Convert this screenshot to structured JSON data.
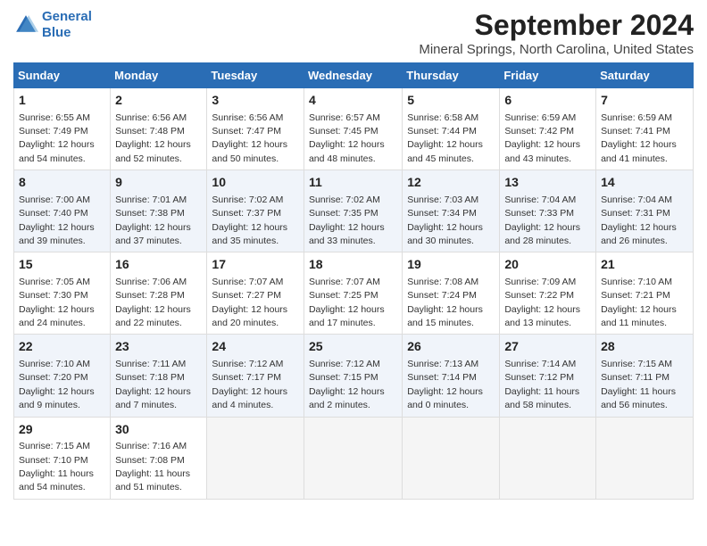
{
  "logo": {
    "line1": "General",
    "line2": "Blue"
  },
  "header": {
    "title": "September 2024",
    "subtitle": "Mineral Springs, North Carolina, United States"
  },
  "weekdays": [
    "Sunday",
    "Monday",
    "Tuesday",
    "Wednesday",
    "Thursday",
    "Friday",
    "Saturday"
  ],
  "weeks": [
    [
      {
        "day": "1",
        "sunrise": "6:55 AM",
        "sunset": "7:49 PM",
        "daylight": "12 hours and 54 minutes."
      },
      {
        "day": "2",
        "sunrise": "6:56 AM",
        "sunset": "7:48 PM",
        "daylight": "12 hours and 52 minutes."
      },
      {
        "day": "3",
        "sunrise": "6:56 AM",
        "sunset": "7:47 PM",
        "daylight": "12 hours and 50 minutes."
      },
      {
        "day": "4",
        "sunrise": "6:57 AM",
        "sunset": "7:45 PM",
        "daylight": "12 hours and 48 minutes."
      },
      {
        "day": "5",
        "sunrise": "6:58 AM",
        "sunset": "7:44 PM",
        "daylight": "12 hours and 45 minutes."
      },
      {
        "day": "6",
        "sunrise": "6:59 AM",
        "sunset": "7:42 PM",
        "daylight": "12 hours and 43 minutes."
      },
      {
        "day": "7",
        "sunrise": "6:59 AM",
        "sunset": "7:41 PM",
        "daylight": "12 hours and 41 minutes."
      }
    ],
    [
      {
        "day": "8",
        "sunrise": "7:00 AM",
        "sunset": "7:40 PM",
        "daylight": "12 hours and 39 minutes."
      },
      {
        "day": "9",
        "sunrise": "7:01 AM",
        "sunset": "7:38 PM",
        "daylight": "12 hours and 37 minutes."
      },
      {
        "day": "10",
        "sunrise": "7:02 AM",
        "sunset": "7:37 PM",
        "daylight": "12 hours and 35 minutes."
      },
      {
        "day": "11",
        "sunrise": "7:02 AM",
        "sunset": "7:35 PM",
        "daylight": "12 hours and 33 minutes."
      },
      {
        "day": "12",
        "sunrise": "7:03 AM",
        "sunset": "7:34 PM",
        "daylight": "12 hours and 30 minutes."
      },
      {
        "day": "13",
        "sunrise": "7:04 AM",
        "sunset": "7:33 PM",
        "daylight": "12 hours and 28 minutes."
      },
      {
        "day": "14",
        "sunrise": "7:04 AM",
        "sunset": "7:31 PM",
        "daylight": "12 hours and 26 minutes."
      }
    ],
    [
      {
        "day": "15",
        "sunrise": "7:05 AM",
        "sunset": "7:30 PM",
        "daylight": "12 hours and 24 minutes."
      },
      {
        "day": "16",
        "sunrise": "7:06 AM",
        "sunset": "7:28 PM",
        "daylight": "12 hours and 22 minutes."
      },
      {
        "day": "17",
        "sunrise": "7:07 AM",
        "sunset": "7:27 PM",
        "daylight": "12 hours and 20 minutes."
      },
      {
        "day": "18",
        "sunrise": "7:07 AM",
        "sunset": "7:25 PM",
        "daylight": "12 hours and 17 minutes."
      },
      {
        "day": "19",
        "sunrise": "7:08 AM",
        "sunset": "7:24 PM",
        "daylight": "12 hours and 15 minutes."
      },
      {
        "day": "20",
        "sunrise": "7:09 AM",
        "sunset": "7:22 PM",
        "daylight": "12 hours and 13 minutes."
      },
      {
        "day": "21",
        "sunrise": "7:10 AM",
        "sunset": "7:21 PM",
        "daylight": "12 hours and 11 minutes."
      }
    ],
    [
      {
        "day": "22",
        "sunrise": "7:10 AM",
        "sunset": "7:20 PM",
        "daylight": "12 hours and 9 minutes."
      },
      {
        "day": "23",
        "sunrise": "7:11 AM",
        "sunset": "7:18 PM",
        "daylight": "12 hours and 7 minutes."
      },
      {
        "day": "24",
        "sunrise": "7:12 AM",
        "sunset": "7:17 PM",
        "daylight": "12 hours and 4 minutes."
      },
      {
        "day": "25",
        "sunrise": "7:12 AM",
        "sunset": "7:15 PM",
        "daylight": "12 hours and 2 minutes."
      },
      {
        "day": "26",
        "sunrise": "7:13 AM",
        "sunset": "7:14 PM",
        "daylight": "12 hours and 0 minutes."
      },
      {
        "day": "27",
        "sunrise": "7:14 AM",
        "sunset": "7:12 PM",
        "daylight": "11 hours and 58 minutes."
      },
      {
        "day": "28",
        "sunrise": "7:15 AM",
        "sunset": "7:11 PM",
        "daylight": "11 hours and 56 minutes."
      }
    ],
    [
      {
        "day": "29",
        "sunrise": "7:15 AM",
        "sunset": "7:10 PM",
        "daylight": "11 hours and 54 minutes."
      },
      {
        "day": "30",
        "sunrise": "7:16 AM",
        "sunset": "7:08 PM",
        "daylight": "11 hours and 51 minutes."
      },
      null,
      null,
      null,
      null,
      null
    ]
  ]
}
